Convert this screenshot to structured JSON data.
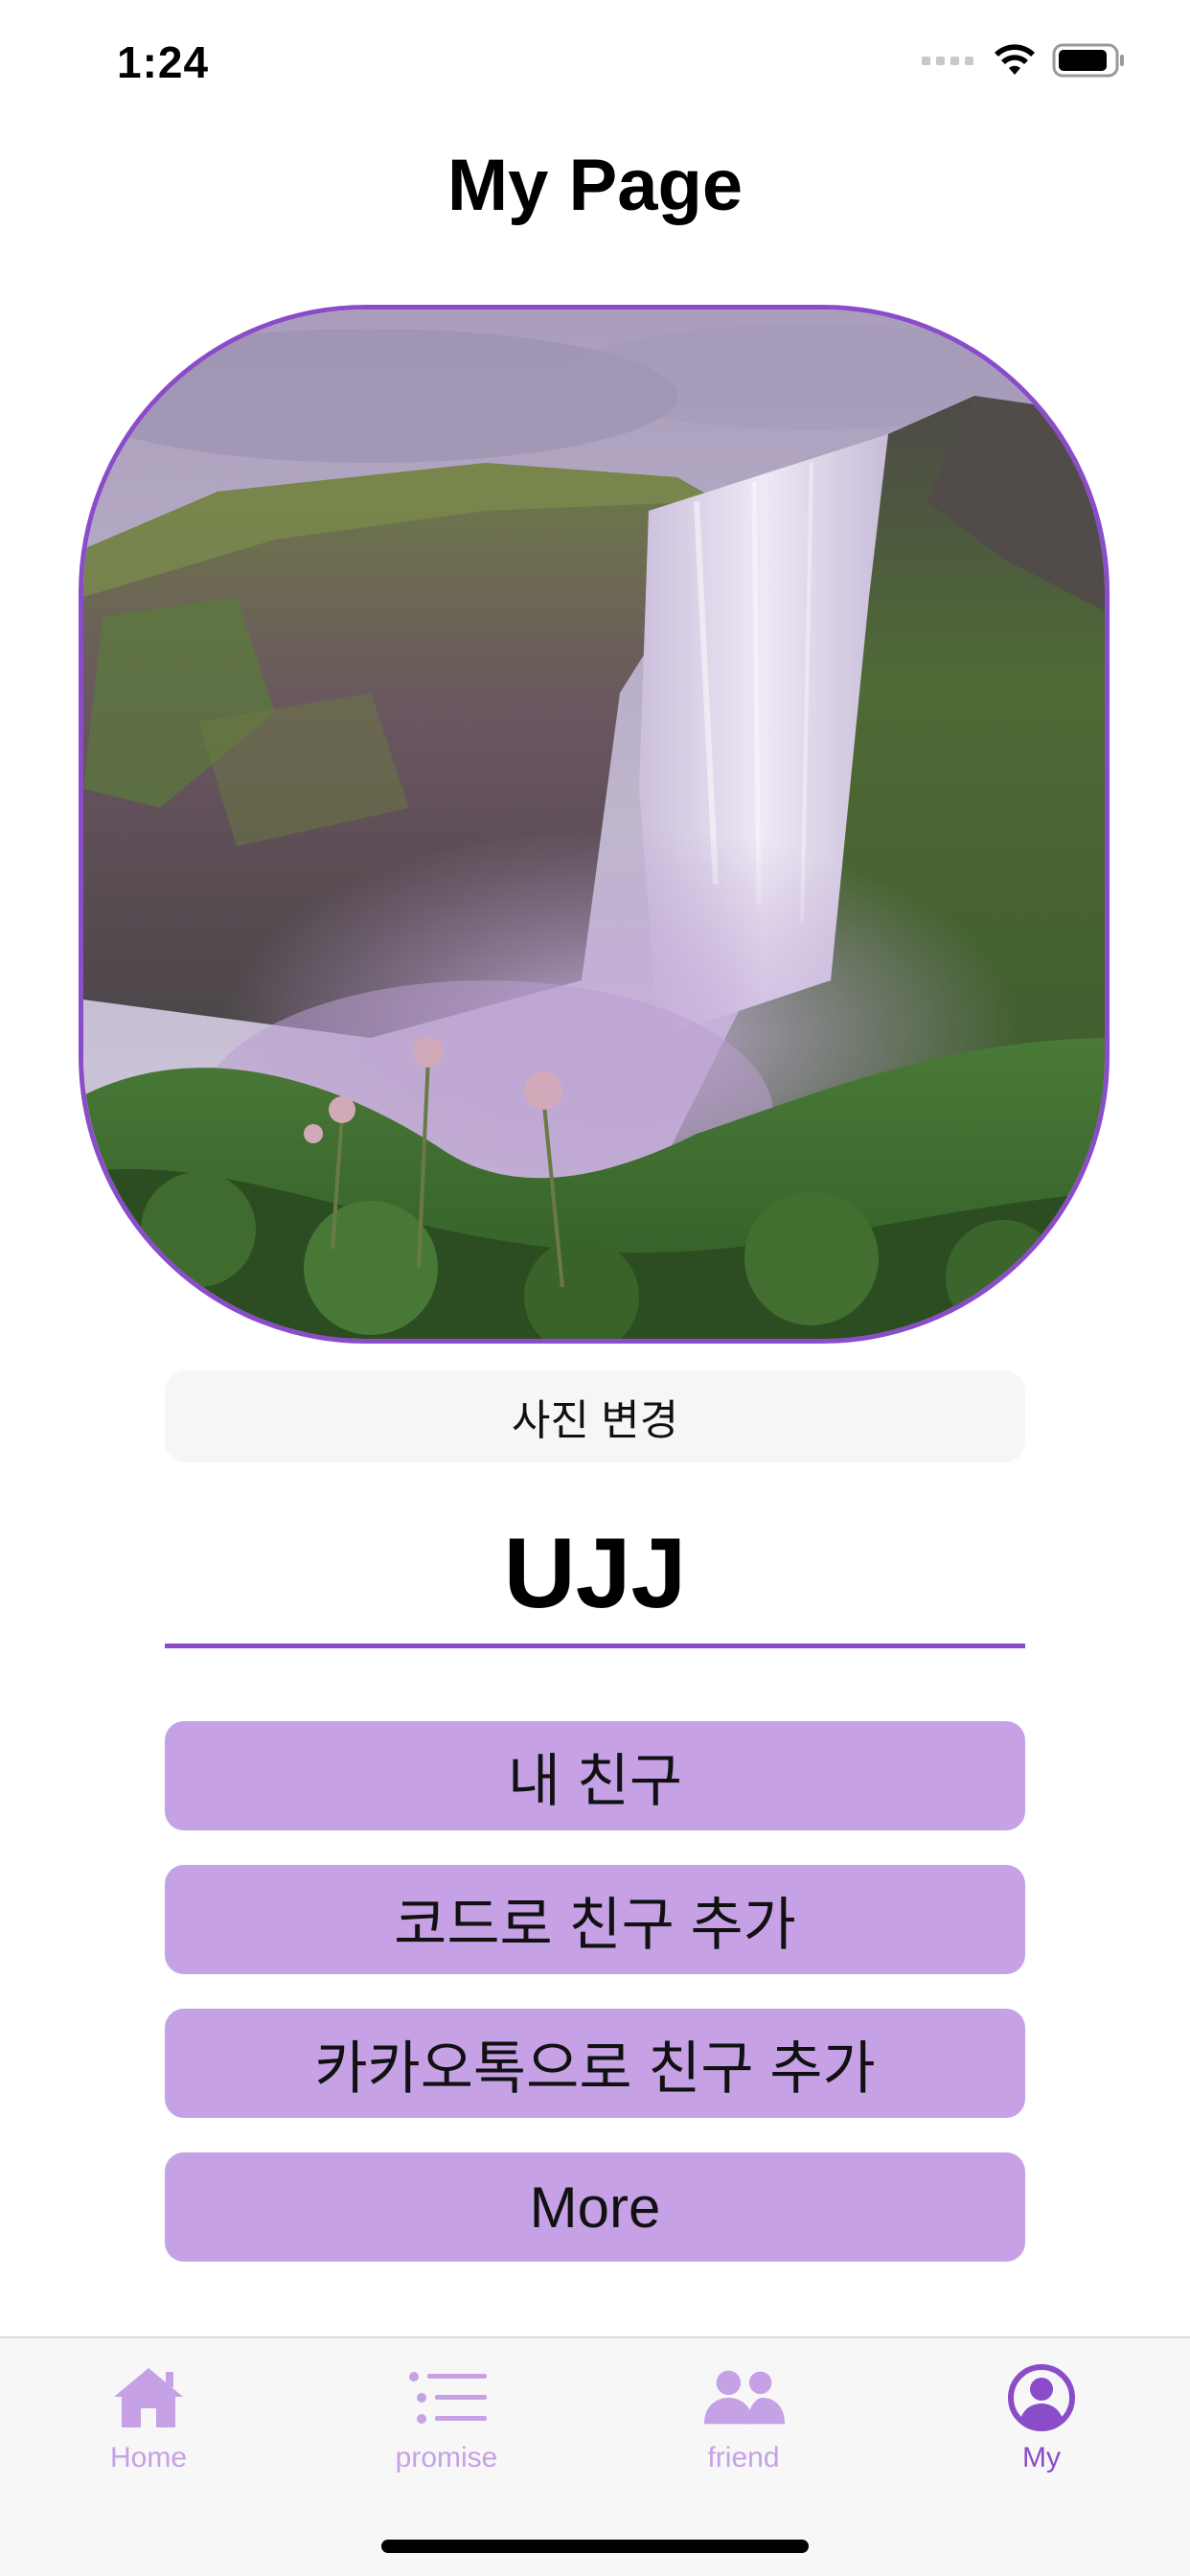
{
  "status_bar": {
    "time": "1:24",
    "icons": [
      "signal-icon",
      "wifi-icon",
      "battery-icon"
    ]
  },
  "header": {
    "title": "My Page"
  },
  "profile": {
    "image": "waterfall-photo",
    "change_photo_label": "사진 변경",
    "name_value": "UJJ"
  },
  "menu": {
    "items": [
      {
        "label": "내 친구"
      },
      {
        "label": "코드로 친구 추가"
      },
      {
        "label": "카카오톡으로 친구 추가"
      },
      {
        "label": "More"
      }
    ]
  },
  "tab_bar": {
    "items": [
      {
        "label": "Home",
        "icon": "home-icon"
      },
      {
        "label": "promise",
        "icon": "list-icon"
      },
      {
        "label": "friend",
        "icon": "people-icon"
      },
      {
        "label": "My",
        "icon": "person-circle-icon"
      }
    ],
    "active_index": 3
  },
  "colors": {
    "accent": "#8a4cc9",
    "button_fill": "#c6a1e6",
    "tab_inactive": "#c6a1e6",
    "tab_active": "#8a4cc9"
  }
}
